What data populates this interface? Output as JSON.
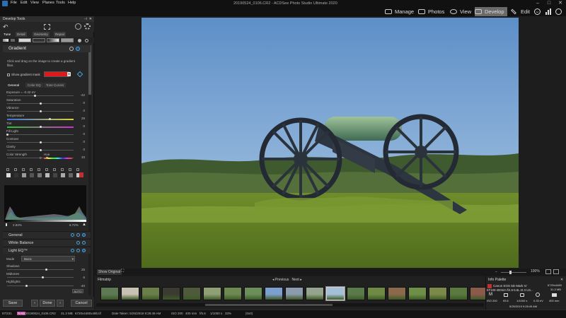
{
  "window": {
    "title": "20190524_0106.CR2 - ACDSee Photo Studio Ultimate 2020",
    "menu": [
      "File",
      "Edit",
      "View",
      "Planes",
      "Tools",
      "Help"
    ]
  },
  "modes": {
    "manage": "Manage",
    "photos": "Photos",
    "view": "View",
    "develop": "Develop",
    "edit": "Edit",
    "active": "Develop"
  },
  "left_panel": {
    "header": "Develop Tools",
    "tabs": [
      "Tune",
      "Detail",
      "Geometry",
      "Repair"
    ],
    "active_tab": "Tune",
    "gradient": {
      "title": "Gradient",
      "description": "Click and drag on the image to create a gradient filter.",
      "show_mask_label": "Show gradient mask",
      "mask_color": "#e01a1a",
      "subtabs": [
        "General",
        "Color EQ",
        "Tone Curves"
      ],
      "active_subtab": "General",
      "sliders": [
        {
          "label": "Exposure = -0.42 eV",
          "value": "-42",
          "pos": 0.42
        },
        {
          "label": "Saturation",
          "value": "0",
          "pos": 0.5
        },
        {
          "label": "Vibrance",
          "value": "0",
          "pos": 0.5
        },
        {
          "label": "Temperature",
          "value": "29",
          "pos": 0.64
        },
        {
          "label": "Tint",
          "value": "0",
          "pos": 0.5
        },
        {
          "label": "Fill Light",
          "value": "0",
          "pos": 0.0
        },
        {
          "label": "Contrast",
          "value": "0",
          "pos": 0.5
        },
        {
          "label": "Clarity",
          "value": "0",
          "pos": 0.5
        },
        {
          "label": "Color Strength",
          "value": "33",
          "pos": 0.6
        }
      ],
      "hue_label": "Hue",
      "color_strength_left": "0"
    },
    "histogram": {
      "left_value": "2.84%",
      "right_value": "6.72%"
    },
    "sections": {
      "general": "General",
      "white_balance": "White Balance",
      "light_eq": "Light EQ™"
    },
    "light_eq": {
      "mode_label": "Mode",
      "mode_value": "Basic",
      "shadows_label": "Shadows",
      "shadows_value": "25",
      "midtones_label": "Midtones",
      "midtones_value": "6",
      "highlights_label": "Highlights",
      "highlights_value": "-40",
      "auto_label": "AUTO"
    },
    "buttons": {
      "save": "Save",
      "done": "Done",
      "cancel": "Cancel"
    }
  },
  "viewer": {
    "show_original": "Show Original",
    "zoom": "100%"
  },
  "filmstrip": {
    "title": "Filmstrip",
    "previous": "Previous",
    "next": "Next",
    "thumbs": [
      "#5d7a55",
      "#c9c2b4",
      "#6a7f4a",
      "#3b3b32",
      "#4f5a3c",
      "#8fa076",
      "#6e8a52",
      "#6b8e5a",
      "#7d9fd0",
      "#8a9cae",
      "#95a48e",
      "#a4c0d8",
      "#5a7a4c",
      "#6e8a45",
      "#8a6a4a",
      "#6f8f48",
      "#7b8a4b",
      "#5b7a40",
      "#8a5a4a"
    ],
    "selected_index": 11
  },
  "info_palette": {
    "title": "Info Palette",
    "camera": "Canon EOS 5D Mark IV",
    "lens": "EF100-400mm f/4.5-5.6L IS II US...",
    "ext": "6720x4480",
    "size": "31.3 MB",
    "iso": "ISO 200",
    "aperture": "f/5.6",
    "shutter": "1/1000 s",
    "ev": "0.33 eV",
    "focal": "400 mm",
    "date": "5/25/2019 9:28:49 AM"
  },
  "status": {
    "index": "87/231",
    "raw_badge": "RAW",
    "filename": "20190524_0106.CR2",
    "filesize": "31.3 MB",
    "dimensions": "6720x4480x48b.tif",
    "date_taken": "Date Taken: 5/25/2019 9:28:49 AM",
    "iso": "ISO 200",
    "focal": "400 mm",
    "aperture": "f/5.6",
    "shutter": "1/1000 s",
    "zoom": "33%",
    "coords": "(0x0)"
  }
}
